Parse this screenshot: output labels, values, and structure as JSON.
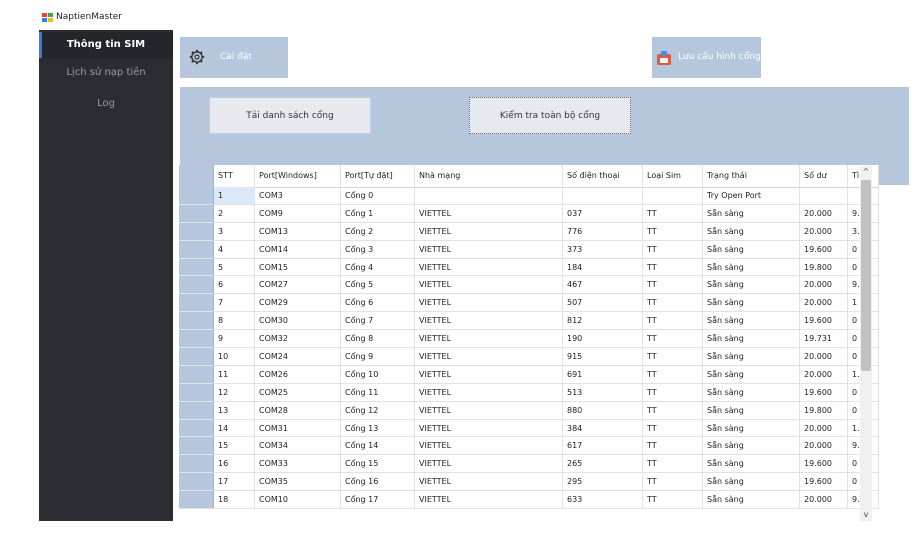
{
  "app": {
    "title": "NaptienMaster"
  },
  "sidebar": {
    "items": [
      {
        "label": "Thông tin SIM",
        "active": true
      },
      {
        "label": "Lịch sử nạp tiền",
        "active": false
      },
      {
        "label": "Log",
        "active": false
      }
    ]
  },
  "toolbar": {
    "settings_label": "Cài đặt",
    "save_label": "Lưu cấu hình cổng"
  },
  "actions": {
    "load_label": "Tải danh sách cổng",
    "check_label": "Kiểm tra toàn bộ cổng"
  },
  "table": {
    "columns": [
      "STT",
      "Port[Windows]",
      "Port[Tự đặt]",
      "Nhà mạng",
      "Số điện thoại",
      "Loại Sim",
      "Trạng thái",
      "Số dư",
      "Tì"
    ],
    "rows": [
      [
        "1",
        "COM3",
        "Cổng 0",
        "",
        "",
        "",
        "Try Open Port",
        "",
        ""
      ],
      [
        "2",
        "COM9",
        "Cổng 1",
        "VIETTEL",
        "037",
        "TT",
        "Sẵn sàng",
        "20.000",
        "9."
      ],
      [
        "3",
        "COM13",
        "Cổng 2",
        "VIETTEL",
        "776",
        "TT",
        "Sẵn sàng",
        "20.000",
        "3."
      ],
      [
        "4",
        "COM14",
        "Cổng 3",
        "VIETTEL",
        "373",
        "TT",
        "Sẵn sàng",
        "19.600",
        "0"
      ],
      [
        "5",
        "COM15",
        "Cổng 4",
        "VIETTEL",
        "184",
        "TT",
        "Sẵn sàng",
        "19.800",
        "0"
      ],
      [
        "6",
        "COM27",
        "Cổng 5",
        "VIETTEL",
        "467",
        "TT",
        "Sẵn sàng",
        "20.000",
        "9."
      ],
      [
        "7",
        "COM29",
        "Cổng 6",
        "VIETTEL",
        "507",
        "TT",
        "Sẵn sàng",
        "20.000",
        "1"
      ],
      [
        "8",
        "COM30",
        "Cổng 7",
        "VIETTEL",
        "812",
        "TT",
        "Sẵn sàng",
        "19.600",
        "0"
      ],
      [
        "9",
        "COM32",
        "Cổng 8",
        "VIETTEL",
        "190",
        "TT",
        "Sẵn sàng",
        "19.731",
        "0"
      ],
      [
        "10",
        "COM24",
        "Cổng 9",
        "VIETTEL",
        "915",
        "TT",
        "Sẵn sàng",
        "20.000",
        "0"
      ],
      [
        "11",
        "COM26",
        "Cổng 10",
        "VIETTEL",
        "691",
        "TT",
        "Sẵn sàng",
        "20.000",
        "1."
      ],
      [
        "12",
        "COM25",
        "Cổng 11",
        "VIETTEL",
        "513",
        "TT",
        "Sẵn sàng",
        "19.600",
        "0"
      ],
      [
        "13",
        "COM28",
        "Cổng 12",
        "VIETTEL",
        "880",
        "TT",
        "Sẵn sàng",
        "19.800",
        "0"
      ],
      [
        "14",
        "COM31",
        "Cổng 13",
        "VIETTEL",
        "384",
        "TT",
        "Sẵn sàng",
        "20.000",
        "1."
      ],
      [
        "15",
        "COM34",
        "Cổng 14",
        "VIETTEL",
        "617",
        "TT",
        "Sẵn sàng",
        "20.000",
        "9."
      ],
      [
        "16",
        "COM33",
        "Cổng 15",
        "VIETTEL",
        "265",
        "TT",
        "Sẵn sàng",
        "19.600",
        "0"
      ],
      [
        "17",
        "COM35",
        "Cổng 16",
        "VIETTEL",
        "295",
        "TT",
        "Sẵn sàng",
        "19.600",
        "0"
      ],
      [
        "18",
        "COM10",
        "Cổng 17",
        "VIETTEL",
        "633",
        "TT",
        "Sẵn sàng",
        "20.000",
        "9."
      ]
    ]
  },
  "scrollbar": {
    "up_glyph": "^",
    "down_glyph": "v"
  },
  "colors": {
    "sidebar_bg": "#2c2d33",
    "accent_panel": "#b6c7dd",
    "active_indicator": "#3d7be0"
  }
}
